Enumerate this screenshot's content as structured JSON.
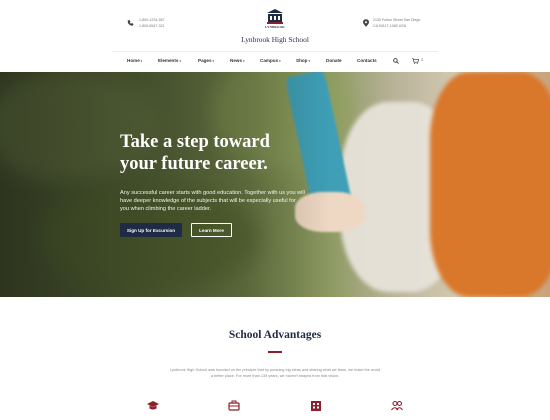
{
  "header": {
    "phone_lines": [
      "1-800-1234-567",
      "1-800-6547-321"
    ],
    "address_lines": [
      "2130 Fulton Street San Diego",
      "CA 94117-1080 USA"
    ],
    "logo_text": "LYNBROOK",
    "site_title": "Lynbrook High School"
  },
  "nav": {
    "items": [
      {
        "label": "Home",
        "has_caret": true
      },
      {
        "label": "Elements",
        "has_caret": true
      },
      {
        "label": "Pages",
        "has_caret": true
      },
      {
        "label": "News",
        "has_caret": true
      },
      {
        "label": "Campus",
        "has_caret": true
      },
      {
        "label": "Shop",
        "has_caret": true
      },
      {
        "label": "Donate",
        "has_caret": false
      },
      {
        "label": "Contacts",
        "has_caret": false
      }
    ],
    "search_icon": "search-icon",
    "cart_icon": "cart-icon",
    "cart_count": "0"
  },
  "hero": {
    "title_line1": "Take a step toward",
    "title_line2": "your future career.",
    "text": "Any successful career starts with good education. Together with us you will have deeper knowledge of the subjects that will be especially useful for you when climbing the career ladder.",
    "primary_button": "Sign Up for Excursion",
    "secondary_button": "Learn More"
  },
  "advantages": {
    "title": "School Advantages",
    "text": "Lynbrook High School was founded on the principle that by pursuing big ideas and sharing what we learn, we make the world a better place. For more than 135 years, we haven't strayed from that vision.",
    "icons": [
      "graduation-cap-icon",
      "briefcase-icon",
      "building-icon",
      "people-icon"
    ]
  },
  "colors": {
    "navy": "#1f2a44",
    "accent": "#8b1f2a"
  }
}
